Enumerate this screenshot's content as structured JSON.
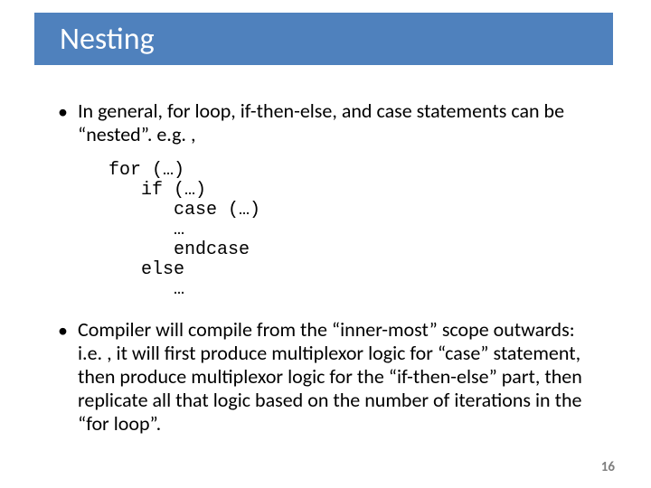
{
  "title": "Nesting",
  "bullets": {
    "b1": "In general, for loop, if-then-else, and case statements can be “nested”.  e.g. ,",
    "b2": "Compiler will compile from the “inner-most” scope outwards: i.e. , it will first produce multiplexor logic for “case” statement, then produce multiplexor logic for the “if-then-else” part, then replicate all that logic based on the number of iterations in the “for loop”."
  },
  "code": "for (…)\n   if (…)\n      case (…)\n      …\n      endcase\n   else\n      …",
  "page_number": "16"
}
